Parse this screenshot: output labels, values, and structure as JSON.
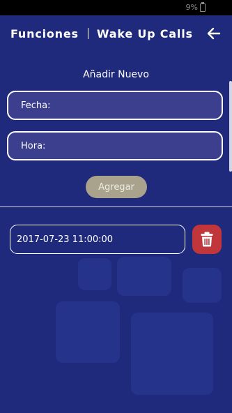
{
  "status": {
    "battery": "9%"
  },
  "header": {
    "brand": "Funciones",
    "title": "Wake Up Calls"
  },
  "form": {
    "section_title": "Añadir Nuevo",
    "fecha_placeholder": "Fecha:",
    "hora_placeholder": "Hora:",
    "add_label": "Agregar"
  },
  "entries": [
    {
      "datetime": "2017-07-23 11:00:00"
    }
  ],
  "colors": {
    "background": "#1f2a7c",
    "field_fill": "#3b3f8e",
    "add_button": "#a9a28c",
    "delete_button": "#c0363a"
  },
  "icons": {
    "back": "arrow-left-icon",
    "delete": "trash-icon",
    "battery": "battery-icon"
  }
}
